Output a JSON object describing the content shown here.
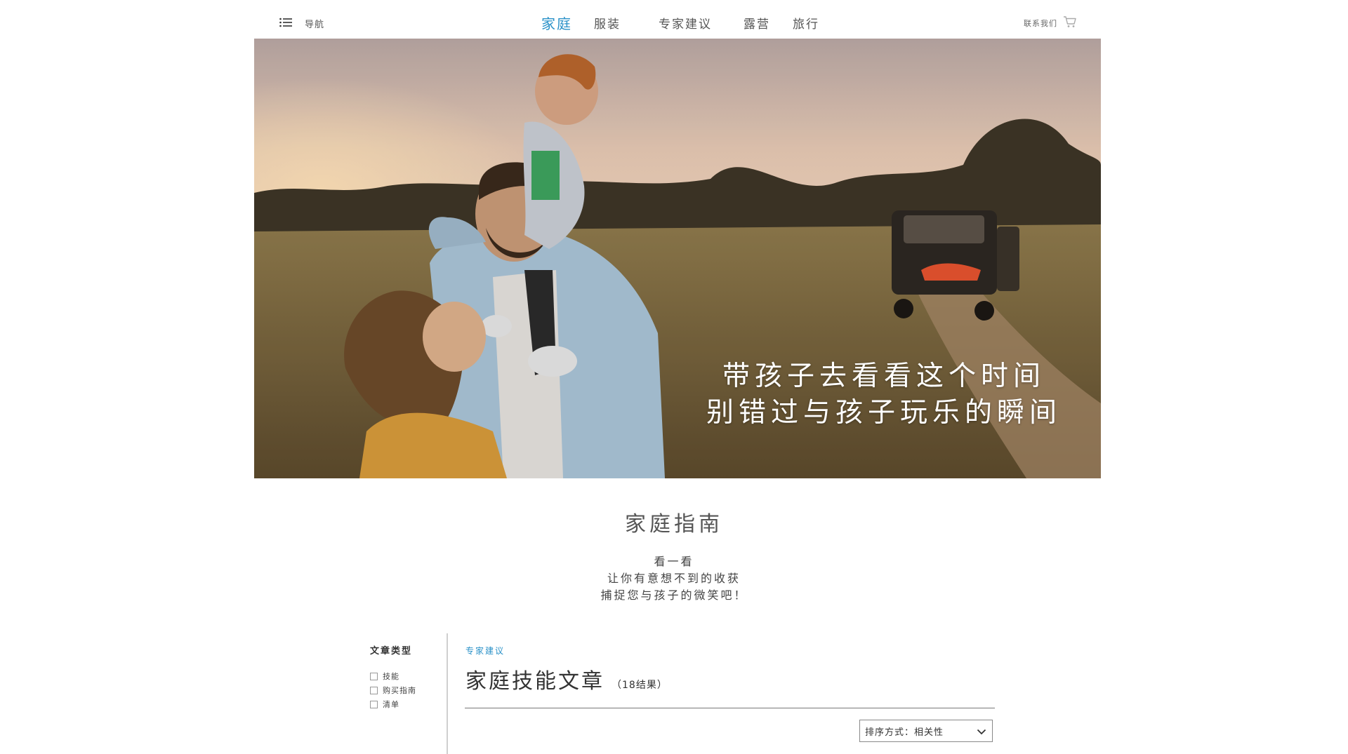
{
  "header": {
    "nav_label": "导航",
    "tabs": [
      {
        "label": "家庭",
        "active": true
      },
      {
        "label": "服装",
        "active": false
      },
      {
        "label": "专家建议",
        "active": false
      },
      {
        "label": "露营",
        "active": false
      },
      {
        "label": "旅行",
        "active": false
      }
    ],
    "contact_label": "联系我们",
    "icons": {
      "menu": "list-menu-icon",
      "cart": "shopping-cart-icon"
    },
    "accent_color": "#2a91c8"
  },
  "hero": {
    "line1": "带孩子去看看这个时间",
    "line2": "别错过与孩子玩乐的瞬间"
  },
  "guide": {
    "title": "家庭指南",
    "lines": [
      "看一看",
      "让你有意想不到的收获",
      "捕捉您与孩子的微笑吧！"
    ]
  },
  "filter": {
    "title": "文章类型",
    "options": [
      "技能",
      "购买指南",
      "清单"
    ]
  },
  "results": {
    "breadcrumb": "专家建议",
    "title": "家庭技能文章",
    "count": "（18结果）",
    "sort_label": "排序方式：相关性"
  }
}
